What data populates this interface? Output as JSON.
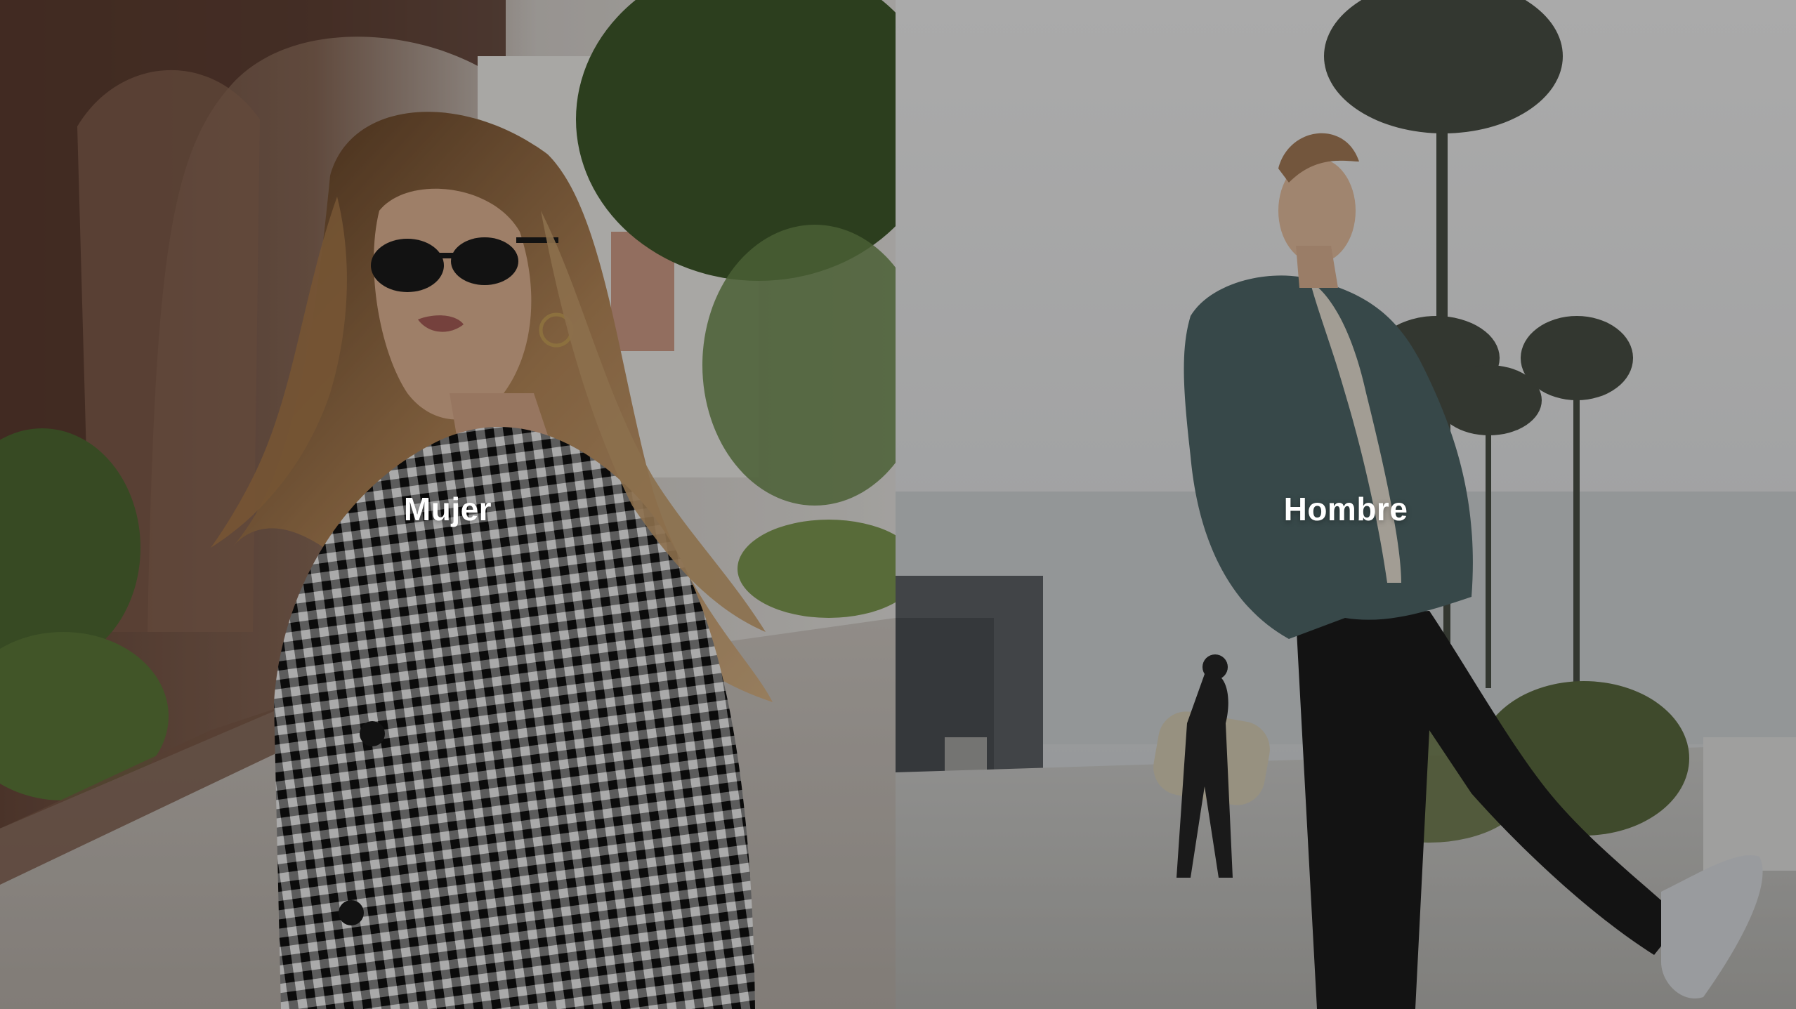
{
  "categories": {
    "women": {
      "label": "Mujer"
    },
    "men": {
      "label": "Hombre"
    }
  },
  "colors": {
    "label_text": "#ffffff",
    "overlay": "rgba(0,0,0,0.30)"
  }
}
